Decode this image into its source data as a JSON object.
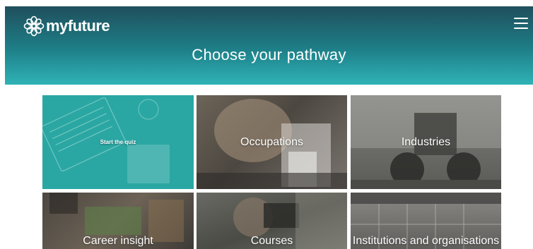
{
  "header": {
    "brand": "myfuture",
    "title": "Choose your pathway",
    "logo_icon": "myfuture-flower-logo-icon",
    "menu_icon": "hamburger-menu-icon",
    "accent_colors": [
      "#1f4f5c",
      "#1e7f88",
      "#2fb3b6"
    ]
  },
  "tiles": [
    {
      "label": "Start the quiz",
      "color": "#2aa7a3",
      "image": "laptop-desk-photo"
    },
    {
      "label": "Occupations",
      "image": "microscope-worker-photo"
    },
    {
      "label": "Industries",
      "image": "wheel-loader-photo"
    },
    {
      "label": "Career insight",
      "image": "electronics-workbench-photo"
    },
    {
      "label": "Courses",
      "image": "camera-operator-photo"
    },
    {
      "label": "Institutions and organisations",
      "image": "building-interior-photo"
    }
  ]
}
